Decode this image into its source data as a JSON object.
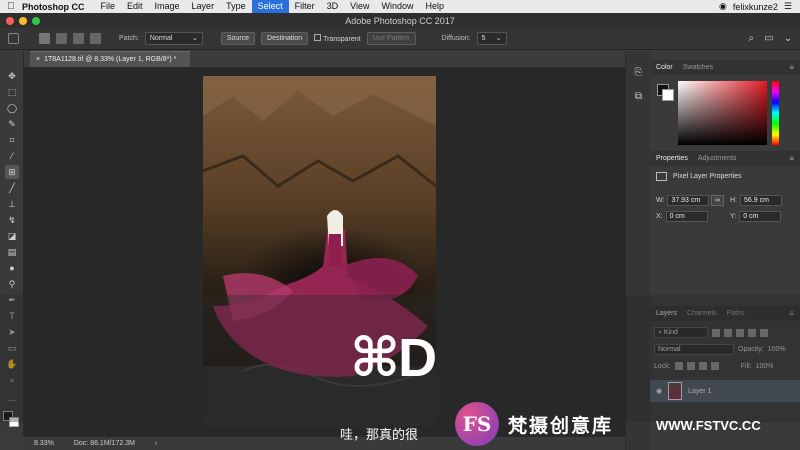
{
  "menubar": {
    "apple": "",
    "app_name": "Photoshop CC",
    "items": [
      "File",
      "Edit",
      "Image",
      "Layer",
      "Type",
      "Select",
      "Filter",
      "3D",
      "View",
      "Window",
      "Help"
    ],
    "selected": "Select",
    "user": "felixkunze2",
    "extra": "☰"
  },
  "window": {
    "title": "Adobe Photoshop CC 2017"
  },
  "options": {
    "patch_label": "Patch:",
    "patch_value": "Normal",
    "source": "Source",
    "destination": "Destination",
    "transparent": "Transparent",
    "use_pattern": "Use Pattern",
    "diffusion_label": "Diffusion:",
    "diffusion_value": "5"
  },
  "document": {
    "tab": "1T8A1128.tif @ 8.33% (Layer 1, RGB/8*) *"
  },
  "status": {
    "zoom": "8.33%",
    "doc": "Doc: 86.1M/172.3M",
    "arrow": "›"
  },
  "color_panel": {
    "tab1": "Color",
    "tab2": "Swatches",
    "fg": "#111111",
    "bg": "#ffffff",
    "accent": "#e11b22"
  },
  "properties": {
    "tab1": "Properties",
    "tab2": "Adjustments",
    "heading": "Pixel Layer Properties",
    "w_label": "W:",
    "w": "37.93 cm",
    "h_label": "H:",
    "h": "56.9 cm",
    "x_label": "X:",
    "x": "0 cm",
    "y_label": "Y:",
    "y": "0 cm"
  },
  "layers": {
    "tab1": "Layers",
    "tab2": "Channels",
    "tab3": "Paths",
    "filter": "Kind",
    "blend": "Normal",
    "opacity_label": "Opacity:",
    "opacity": "100%",
    "lock_label": "Lock:",
    "fill_label": "Fill:",
    "fill": "100%",
    "layer_name": "Layer 1"
  },
  "overlay": {
    "shortcut": "⌘D",
    "subtitle": "哇，那真的很",
    "logo_mark": "FS",
    "logo_text": "梵摄创意库",
    "logo_url": "WWW.FSTVC.CC"
  }
}
